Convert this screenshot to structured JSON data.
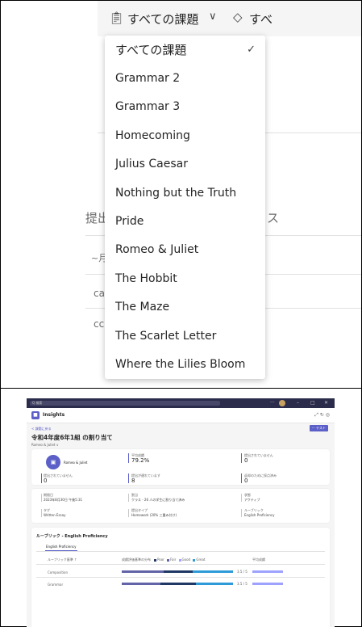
{
  "top": {
    "filter": {
      "icon": "clipboard-icon",
      "label": "すべての課題",
      "chevron": "chevron-down-icon",
      "tag_icon": "tag-icon",
      "tag_label": "すべ"
    },
    "ghost_texts": [
      "提出",
      "ス",
      "~月",
      "ca",
      "cc"
    ],
    "dropdown": {
      "selected": "すべての課題",
      "items": [
        "すべての課題",
        "Grammar 2",
        "Grammar 3",
        "Homecoming",
        "Julius Caesar",
        "Nothing but the Truth",
        "Pride",
        "Romeo & Juliet",
        "The Hobbit",
        "The Maze",
        "The Scarlet Letter",
        "Where the Lilies Bloom"
      ]
    }
  },
  "teams": {
    "search_placeholder": "Q 検索",
    "app_title": "Insights",
    "back_link": "< 課題に戻る",
    "publish_button": "···  テスト",
    "page_title": "令和4年度6年1組 の割り当て",
    "sub_filter": "Romeo & Juliet ∨",
    "summary": {
      "assignment_name": "Romeo & Juliet",
      "stats": [
        {
          "label": "平均成績",
          "value": "79.2%"
        },
        {
          "label": "提出されていません",
          "value": "0"
        },
        {
          "label": "提出されていません",
          "value": "0"
        },
        {
          "label": "提出が遅れています",
          "value": "8"
        },
        {
          "label": "返却のために採点済み",
          "value": "0"
        }
      ]
    },
    "details": [
      {
        "label": "期限日",
        "value": "2023年8月30日 午後5:31"
      },
      {
        "label": "割当",
        "value": "クラス - 26 人の学生に割り当て済み"
      },
      {
        "label": "状態",
        "value": "アクティブ"
      },
      {
        "label": "タグ",
        "value": "Written Essay"
      },
      {
        "label": "提出タイプ",
        "value": "Homework (20% 三重み付け)"
      },
      {
        "label": "ルーブリック",
        "value": "English Proficiency"
      }
    ],
    "rubric": {
      "title": "ルーブリック - English Proficiency",
      "tab": "English Proficiency",
      "col_criteria": "ルーブリック基準 ↑",
      "col_dist": "成績評価基準の分布",
      "legend": [
        "Poor",
        "Fair",
        "Good",
        "Great"
      ],
      "col_avg": "平均成績",
      "rows": [
        {
          "name": "Composition",
          "avg": "3.5 / 5"
        },
        {
          "name": "Grammar",
          "avg": "3.5 / 5"
        }
      ],
      "colors": {
        "poor": "#1f3864",
        "fair": "#6264a7",
        "good": "#9ea2ff",
        "great": "#2e9bd8"
      }
    }
  }
}
